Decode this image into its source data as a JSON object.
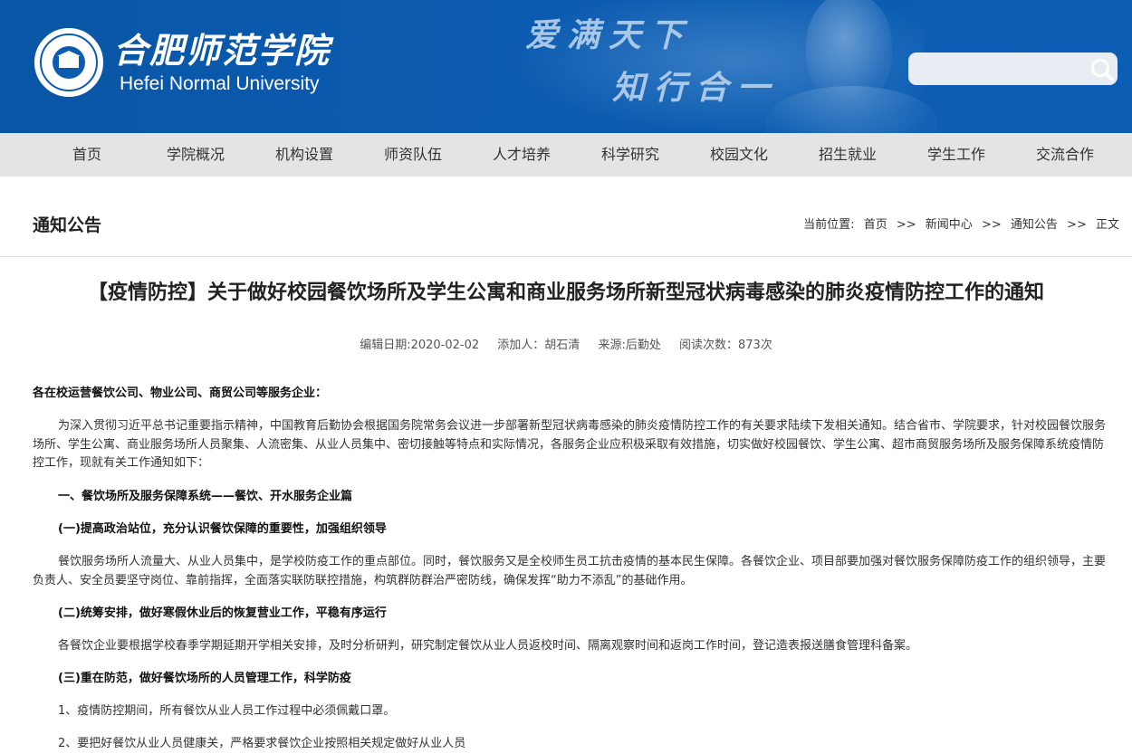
{
  "header": {
    "logo_cn": "合肥师范学院",
    "logo_en": "Hefei Normal University",
    "slogan_line1": "爱满天下",
    "slogan_line2": "知行合一",
    "search": {
      "value": "",
      "placeholder": ""
    }
  },
  "nav": {
    "items": [
      "首页",
      "学院概况",
      "机构设置",
      "师资队伍",
      "人才培养",
      "科学研究",
      "校园文化",
      "招生就业",
      "学生工作",
      "交流合作"
    ]
  },
  "section": {
    "title": "通知公告",
    "breadcrumb_prefix": "当前位置:",
    "breadcrumb": [
      "首页",
      "新闻中心",
      "通知公告",
      "正文"
    ],
    "separator": ">>"
  },
  "article": {
    "title": "【疫情防控】关于做好校园餐饮场所及学生公寓和商业服务场所新型冠状病毒感染的肺炎疫情防控工作的通知",
    "meta": {
      "date": "编辑日期:2020-02-02",
      "author": "添加人：胡石清",
      "source": "来源:后勤处",
      "views": "阅读次数：873次"
    },
    "salutation": "各在校运营餐饮公司、物业公司、商贸公司等服务企业：",
    "intro": "为深入贯彻习近平总书记重要指示精神，中国教育后勤协会根据国务院常务会议进一步部署新型冠状病毒感染的肺炎疫情防控工作的有关要求陆续下发相关通知。结合省市、学院要求，针对校园餐饮服务场所、学生公寓、商业服务场所人员聚集、人流密集、从业人员集中、密切接触等特点和实际情况，各服务企业应积极采取有效措施，切实做好校园餐饮、学生公寓、超市商贸服务场所及服务保障系统疫情防控工作，现就有关工作通知如下：",
    "heading1": "一、餐饮场所及服务保障系统——餐饮、开水服务企业篇",
    "sub1": "(一)提高政治站位，充分认识餐饮保障的重要性，加强组织领导",
    "text1": "餐饮服务场所人流量大、从业人员集中，是学校防疫工作的重点部位。同时，餐饮服务又是全校师生员工抗击疫情的基本民生保障。各餐饮企业、项目部要加强对餐饮服务保障防疫工作的组织领导，主要负责人、安全员要坚守岗位、靠前指挥，全面落实联防联控措施，构筑群防群治严密防线，确保发挥“助力不添乱”的基础作用。",
    "sub2": "(二)统筹安排，做好寒假休业后的恢复营业工作，平稳有序运行",
    "text2": "各餐饮企业要根据学校春季学期延期开学相关安排，及时分析研判，研究制定餐饮从业人员返校时间、隔离观察时间和返岗工作时间，登记造表报送膳食管理科备案。",
    "sub3": "(三)重在防范，做好餐饮场所的人员管理工作，科学防疫",
    "text3": "1、疫情防控期间，所有餐饮从业人员工作过程中必须佩戴口罩。",
    "text4": "2、要把好餐饮从业人员健康关，严格要求餐饮企业按照相关规定做好从业人员"
  }
}
